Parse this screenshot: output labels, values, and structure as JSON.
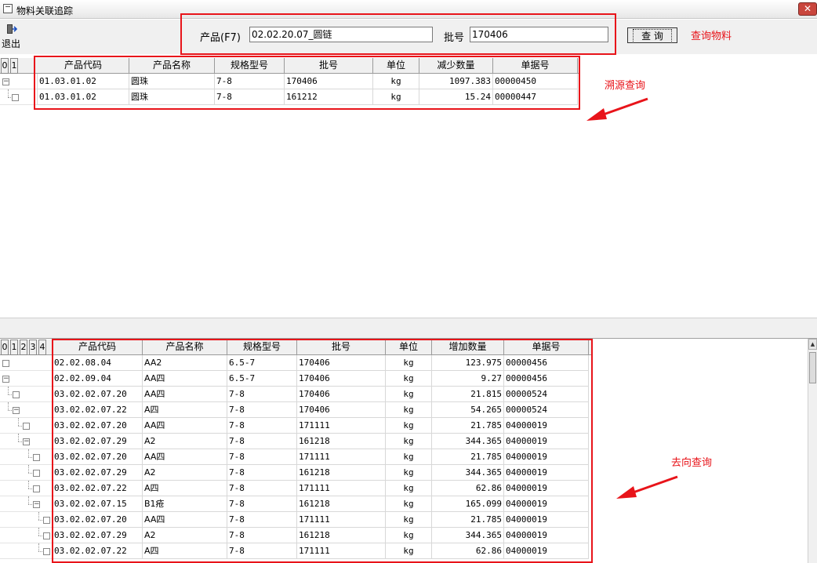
{
  "window": {
    "title": "物料关联追踪",
    "close_glyph": "✕"
  },
  "toolbar": {
    "exit_label": "退出",
    "exit_icon": "exit-door-icon"
  },
  "query": {
    "product_label": "产品(F7)",
    "product_value": "02.02.20.07_圆链",
    "batch_label": "批号",
    "batch_value": "170406",
    "search_button": "查 询"
  },
  "annotations": {
    "query_material": "查询物料",
    "trace_source": "溯源查询",
    "trace_destination": "去向查询",
    "color": "#e8141a"
  },
  "source_grid": {
    "levels": [
      "0",
      "1"
    ],
    "columns": [
      "产品代码",
      "产品名称",
      "规格型号",
      "批号",
      "单位",
      "减少数量",
      "单据号"
    ],
    "rows": [
      {
        "level": 0,
        "expander": "⊟",
        "cells": [
          "01.03.01.02",
          "圆珠",
          "7-8",
          "170406",
          "kg",
          "1097.383",
          "00000450"
        ]
      },
      {
        "level": 1,
        "expander": "",
        "cells": [
          "01.03.01.02",
          "圆珠",
          "7-8",
          "161212",
          "kg",
          "15.24",
          "00000447"
        ]
      }
    ]
  },
  "destination_grid": {
    "levels": [
      "0",
      "1",
      "2",
      "3",
      "4"
    ],
    "columns": [
      "产品代码",
      "产品名称",
      "规格型号",
      "批号",
      "单位",
      "增加数量",
      "单据号"
    ],
    "rows": [
      {
        "level": 0,
        "expander": "",
        "cells": [
          "02.02.08.04",
          "AA2",
          "6.5-7",
          "170406",
          "kg",
          "123.975",
          "00000456"
        ]
      },
      {
        "level": 0,
        "expander": "⊟",
        "cells": [
          "02.02.09.04",
          "AA四",
          "6.5-7",
          "170406",
          "kg",
          "9.27",
          "00000456"
        ]
      },
      {
        "level": 1,
        "expander": "",
        "cells": [
          "03.02.02.07.20",
          "AA四",
          "7-8",
          "170406",
          "kg",
          "21.815",
          "00000524"
        ]
      },
      {
        "level": 1,
        "expander": "⊟",
        "cells": [
          "03.02.02.07.22",
          "A四",
          "7-8",
          "170406",
          "kg",
          "54.265",
          "00000524"
        ]
      },
      {
        "level": 2,
        "expander": "",
        "cells": [
          "03.02.02.07.20",
          "AA四",
          "7-8",
          "171111",
          "kg",
          "21.785",
          "04000019"
        ]
      },
      {
        "level": 2,
        "expander": "⊟",
        "cells": [
          "03.02.02.07.29",
          "A2",
          "7-8",
          "161218",
          "kg",
          "344.365",
          "04000019"
        ]
      },
      {
        "level": 3,
        "expander": "",
        "cells": [
          "03.02.02.07.20",
          "AA四",
          "7-8",
          "171111",
          "kg",
          "21.785",
          "04000019"
        ]
      },
      {
        "level": 3,
        "expander": "",
        "cells": [
          "03.02.02.07.29",
          "A2",
          "7-8",
          "161218",
          "kg",
          "344.365",
          "04000019"
        ]
      },
      {
        "level": 3,
        "expander": "",
        "cells": [
          "03.02.02.07.22",
          "A四",
          "7-8",
          "171111",
          "kg",
          "62.86",
          "04000019"
        ]
      },
      {
        "level": 3,
        "expander": "⊟",
        "cells": [
          "03.02.02.07.15",
          "B1疮",
          "7-8",
          "161218",
          "kg",
          "165.099",
          "04000019"
        ]
      },
      {
        "level": 4,
        "expander": "",
        "cells": [
          "03.02.02.07.20",
          "AA四",
          "7-8",
          "171111",
          "kg",
          "21.785",
          "04000019"
        ]
      },
      {
        "level": 4,
        "expander": "",
        "cells": [
          "03.02.02.07.29",
          "A2",
          "7-8",
          "161218",
          "kg",
          "344.365",
          "04000019"
        ]
      },
      {
        "level": 4,
        "expander": "",
        "cells": [
          "03.02.02.07.22",
          "A四",
          "7-8",
          "171111",
          "kg",
          "62.86",
          "04000019"
        ]
      }
    ]
  },
  "scrollbar": {
    "up_glyph": "▲",
    "down_glyph": "▼"
  }
}
